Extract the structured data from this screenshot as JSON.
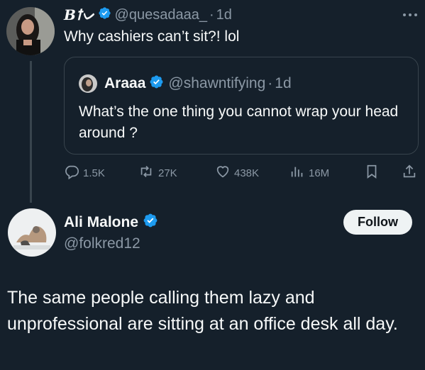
{
  "original_tweet": {
    "display_name": "Bꝉᨆ",
    "handle": "@quesadaaa_",
    "time": "1d",
    "text": "Why cashiers can’t sit?! lol",
    "more_icon": "more-horizontal-icon"
  },
  "quoted_tweet": {
    "display_name": "Araaa",
    "handle": "@shawntifying",
    "time": "1d",
    "text": "What’s the one thing you cannot wrap your head around ?"
  },
  "actions": {
    "replies": "1.5K",
    "reposts": "27K",
    "likes": "438K",
    "views": "16M"
  },
  "reply": {
    "display_name": "Ali Malone",
    "handle": "@folkred12",
    "follow_label": "Follow",
    "text": "The same people calling them lazy and unprofessional are sitting at an office desk all day."
  },
  "colors": {
    "background": "#15202b",
    "verified": "#1d9bf0",
    "muted": "#8b98a5",
    "border": "#38444d"
  }
}
